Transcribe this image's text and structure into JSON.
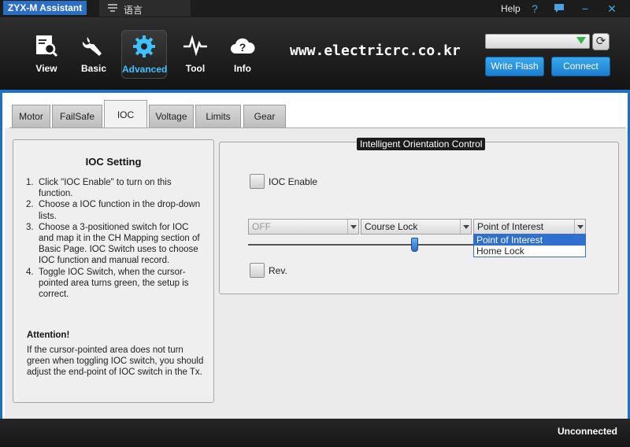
{
  "titlebar": {
    "app_title": "ZYX-M Assistant",
    "lang_icon": "menu-icon",
    "lang_label": "语言",
    "help_label": "Help",
    "help_icon_glyph": "?",
    "chat_icon_glyph": "▭",
    "minimize_glyph": "−",
    "close_glyph": "✕"
  },
  "toolbar": {
    "tools": [
      {
        "label": "View",
        "icon": "magnifier-document-icon"
      },
      {
        "label": "Basic",
        "icon": "wrench-icon"
      },
      {
        "label": "Advanced",
        "icon": "gear-icon"
      },
      {
        "label": "Tool",
        "icon": "pulse-icon"
      },
      {
        "label": "Info",
        "icon": "question-cloud-icon"
      }
    ],
    "active_tool": "Advanced",
    "brand_text": "www.electricrc.co.kr",
    "port_value": "",
    "refresh_glyph": "⟳",
    "write_flash_label": "Write Flash",
    "connect_label": "Connect",
    "accent_color": "#1f6fc2",
    "active_label_color": "#3fc1ff"
  },
  "tabs": [
    "Motor",
    "FailSafe",
    "IOC",
    "Voltage",
    "Limits",
    "Gear"
  ],
  "active_tab": "IOC",
  "info_panel": {
    "title": "IOC Setting",
    "steps": [
      {
        "num": "1.",
        "text": "Click \"IOC Enable\" to turn on this function."
      },
      {
        "num": "2.",
        "text": "Choose a IOC function in the drop-down lists."
      },
      {
        "num": "3.",
        "text": "Choose a 3-positioned switch for IOC and map it in the CH Mapping section of Basic Page. IOC Switch uses to choose IOC function and manual record."
      },
      {
        "num": "4.",
        "text": "Toggle IOC Switch, when the cursor-pointed area turns green, the setup is correct."
      }
    ],
    "attention_title": "Attention!",
    "attention_text": "If the cursor-pointed area does not turn green when toggling IOC switch, you should adjust the end-point of IOC switch in the Tx."
  },
  "ioc_panel": {
    "legend": "Intelligent Orientation Control",
    "enable_label": "IOC Enable",
    "dropdowns": [
      {
        "value": "OFF",
        "disabled": true
      },
      {
        "value": "Course Lock",
        "disabled": false
      },
      {
        "value": "Point of Interest",
        "disabled": false
      }
    ],
    "dropdown_options": [
      "Point of Interest",
      "Home Lock"
    ],
    "selected_option": "Point of Interest",
    "rev_label": "Rev.",
    "slider_position_fraction": 0.73
  },
  "status": {
    "text": "Unconnected"
  }
}
